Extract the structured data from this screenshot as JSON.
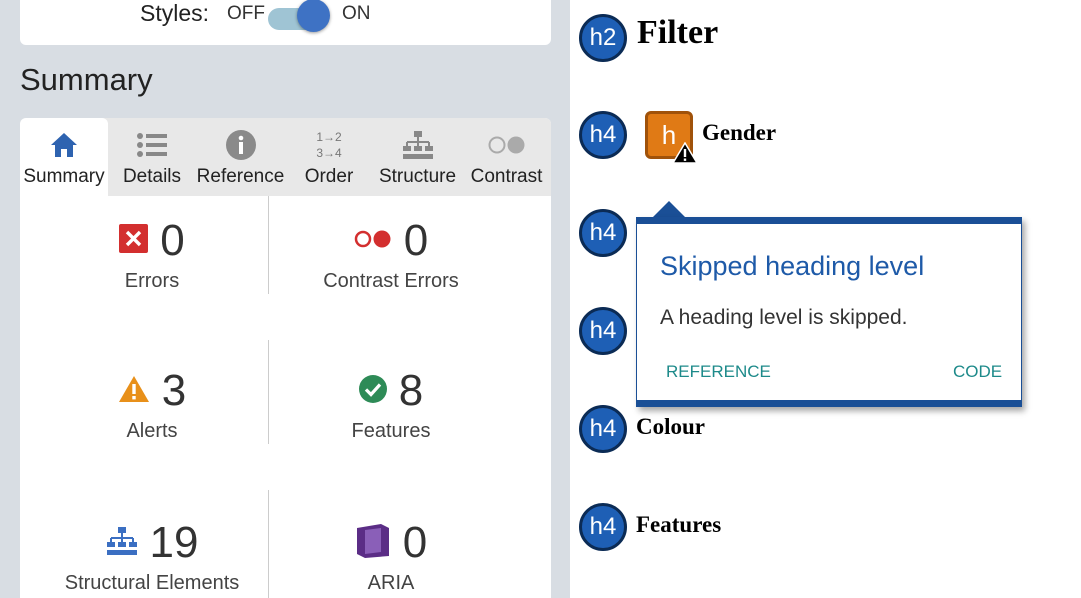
{
  "styles": {
    "label": "Styles:",
    "off": "OFF",
    "on": "ON",
    "enabled": true
  },
  "summary": {
    "title": "Summary"
  },
  "tabs": [
    {
      "label": "Summary",
      "icon": "home-icon",
      "active": true
    },
    {
      "label": "Details",
      "icon": "list-icon"
    },
    {
      "label": "Reference",
      "icon": "info-icon"
    },
    {
      "label": "Order",
      "icon": "order-icon",
      "glyph_top": "1→2",
      "glyph_bottom": "3→4"
    },
    {
      "label": "Structure",
      "icon": "structure-icon"
    },
    {
      "label": "Contrast",
      "icon": "contrast-icon"
    }
  ],
  "stats": {
    "errors": {
      "value": "0",
      "label": "Errors",
      "icon": "error-icon"
    },
    "contrast_errors": {
      "value": "0",
      "label": "Contrast Errors",
      "icon": "contrast-error-icon"
    },
    "alerts": {
      "value": "3",
      "label": "Alerts",
      "icon": "alert-icon"
    },
    "features": {
      "value": "8",
      "label": "Features",
      "icon": "feature-check-icon"
    },
    "structural": {
      "value": "19",
      "label": "Structural Elements",
      "icon": "structure-icon"
    },
    "aria": {
      "value": "0",
      "label": "ARIA",
      "icon": "aria-icon"
    }
  },
  "headings": [
    {
      "badge": "h2",
      "text": "Filter"
    },
    {
      "badge": "h4",
      "text": "Gender"
    },
    {
      "badge": "h4",
      "text": ""
    },
    {
      "badge": "h4",
      "text": ""
    },
    {
      "badge": "h4",
      "text": "Colour"
    },
    {
      "badge": "h4",
      "text": "Features"
    }
  ],
  "gender_icon": {
    "glyph": "h"
  },
  "popup": {
    "title": "Skipped heading level",
    "message": "A heading level is skipped.",
    "reference": "REFERENCE",
    "code": "CODE"
  },
  "colors": {
    "accent_blue": "#1e5fb5",
    "error_red": "#d32f2f",
    "alert_orange": "#e8901a",
    "feature_green": "#2e8b57",
    "aria_purple": "#5b2d86",
    "link_teal": "#1d8a8a"
  }
}
